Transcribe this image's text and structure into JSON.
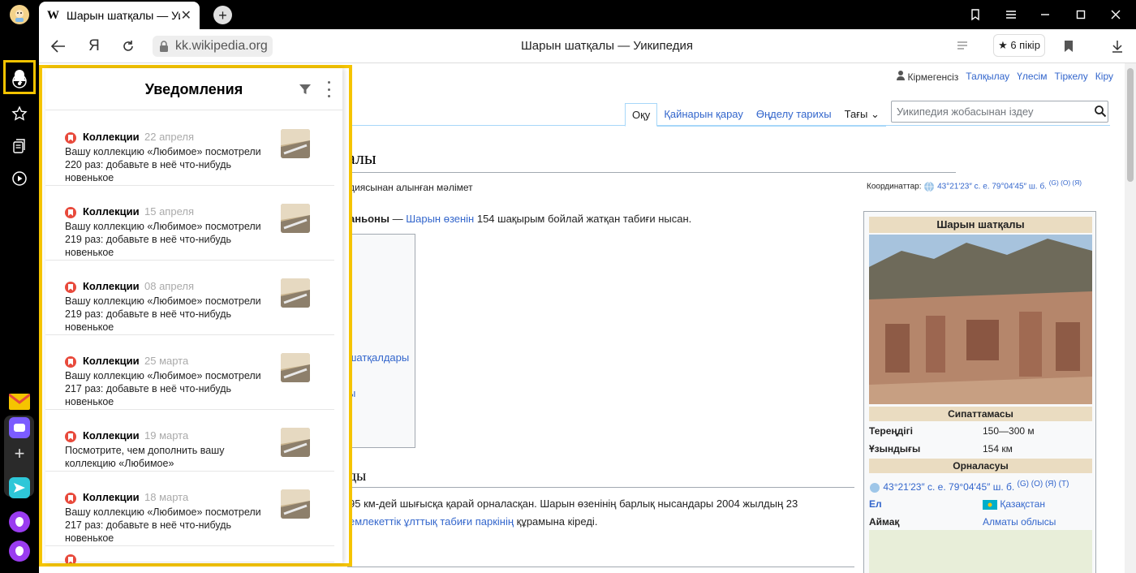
{
  "browser": {
    "tab": {
      "favicon": "W",
      "title": "Шарын шатқалы — Уикипедия",
      "close": "✕"
    },
    "new_tab": "+",
    "url": "kk.wikipedia.org",
    "page_title": "Шарын шатқалы — Уикипедия",
    "reviews_label": "★ 6 пікір"
  },
  "sidebar": {
    "icons": [
      "bell-icon",
      "history-icon",
      "star-icon",
      "collections-icon",
      "play-icon"
    ],
    "apps": [
      "mail-icon",
      "messenger-icon",
      "add-icon",
      "send-icon",
      "alice-icon",
      "alice-icon"
    ]
  },
  "wiki": {
    "userbar": {
      "not_logged": "Кірмегенсіз",
      "talk": "Талқылау",
      "contrib": "Үлесім",
      "create": "Тіркелу",
      "login": "Кіру"
    },
    "tabs": [
      "Оқу",
      "Қайнарын қарау",
      "Өңделу тарихы",
      "Тағы"
    ],
    "search_placeholder": "Уикипедия жобасынан іздеу",
    "h1": "алы",
    "from": "диясынан алынған мәлімет",
    "coords_label": "Координаттар:",
    "coords_value": "43°21′23″ с. е. 79°04′45″ ш. б.",
    "coords_flags": "(G) (O) (Я)",
    "p1_bold": "аньоны",
    "p1_dash": " — ",
    "p1_link": "Шарын өзенін",
    "p1_rest": " 154 шақырым бойлай жатқан табиғи нысан.",
    "toc_items": [
      "]",
      "шатқалдары",
      "ы"
    ],
    "h2": "ды",
    "text_line1": " 95 км-дей шығысқа қарай орналасқан. Шарын өзенінің барлық нысандары 2004 жылдың 23",
    "text_link": "емлекеттік ұлттық табиғи паркінің",
    "text_rest": " құрамына кіреді.",
    "infobox": {
      "title": "Шарын шатқалы",
      "section1": "Сипаттамасы",
      "depth_k": "Тереңдігі",
      "depth_v": "150—300 м",
      "length_k": "Ұзындығы",
      "length_v": "154 км",
      "section2": "Орналасуы",
      "coord": "43°21′23″ с. е. 79°04′45″ ш. б.",
      "coord_flags": "(G) (O) (Я) (T)",
      "country_k": "Ел",
      "country_v": "Қазақстан",
      "region_k": "Аймақ",
      "region_v": "Алматы облысы"
    }
  },
  "notifications": {
    "title": "Уведомления",
    "items": [
      {
        "source": "Коллекции",
        "date": "22 апреля",
        "text": "Вашу коллекцию «Любимое» посмотрели 220 раз: добавьте в неё что-нибудь новенькое"
      },
      {
        "source": "Коллекции",
        "date": "15 апреля",
        "text": "Вашу коллекцию «Любимое» посмотрели 219 раз: добавьте в неё что-нибудь новенькое"
      },
      {
        "source": "Коллекции",
        "date": "08 апреля",
        "text": "Вашу коллекцию «Любимое» посмотрели 219 раз: добавьте в неё что-нибудь новенькое"
      },
      {
        "source": "Коллекции",
        "date": "25 марта",
        "text": "Вашу коллекцию «Любимое» посмотрели 217 раз: добавьте в неё что-нибудь новенькое"
      },
      {
        "source": "Коллекции",
        "date": "19 марта",
        "text": "Посмотрите, чем дополнить вашу коллекцию «Любимое»"
      },
      {
        "source": "Коллекции",
        "date": "18 марта",
        "text": "Вашу коллекцию «Любимое» посмотрели 217 раз: добавьте в неё что-нибудь новенькое"
      }
    ]
  },
  "colors": {
    "highlight": "#f5c400",
    "link": "#3366cc",
    "badge": "#e84a3c"
  }
}
